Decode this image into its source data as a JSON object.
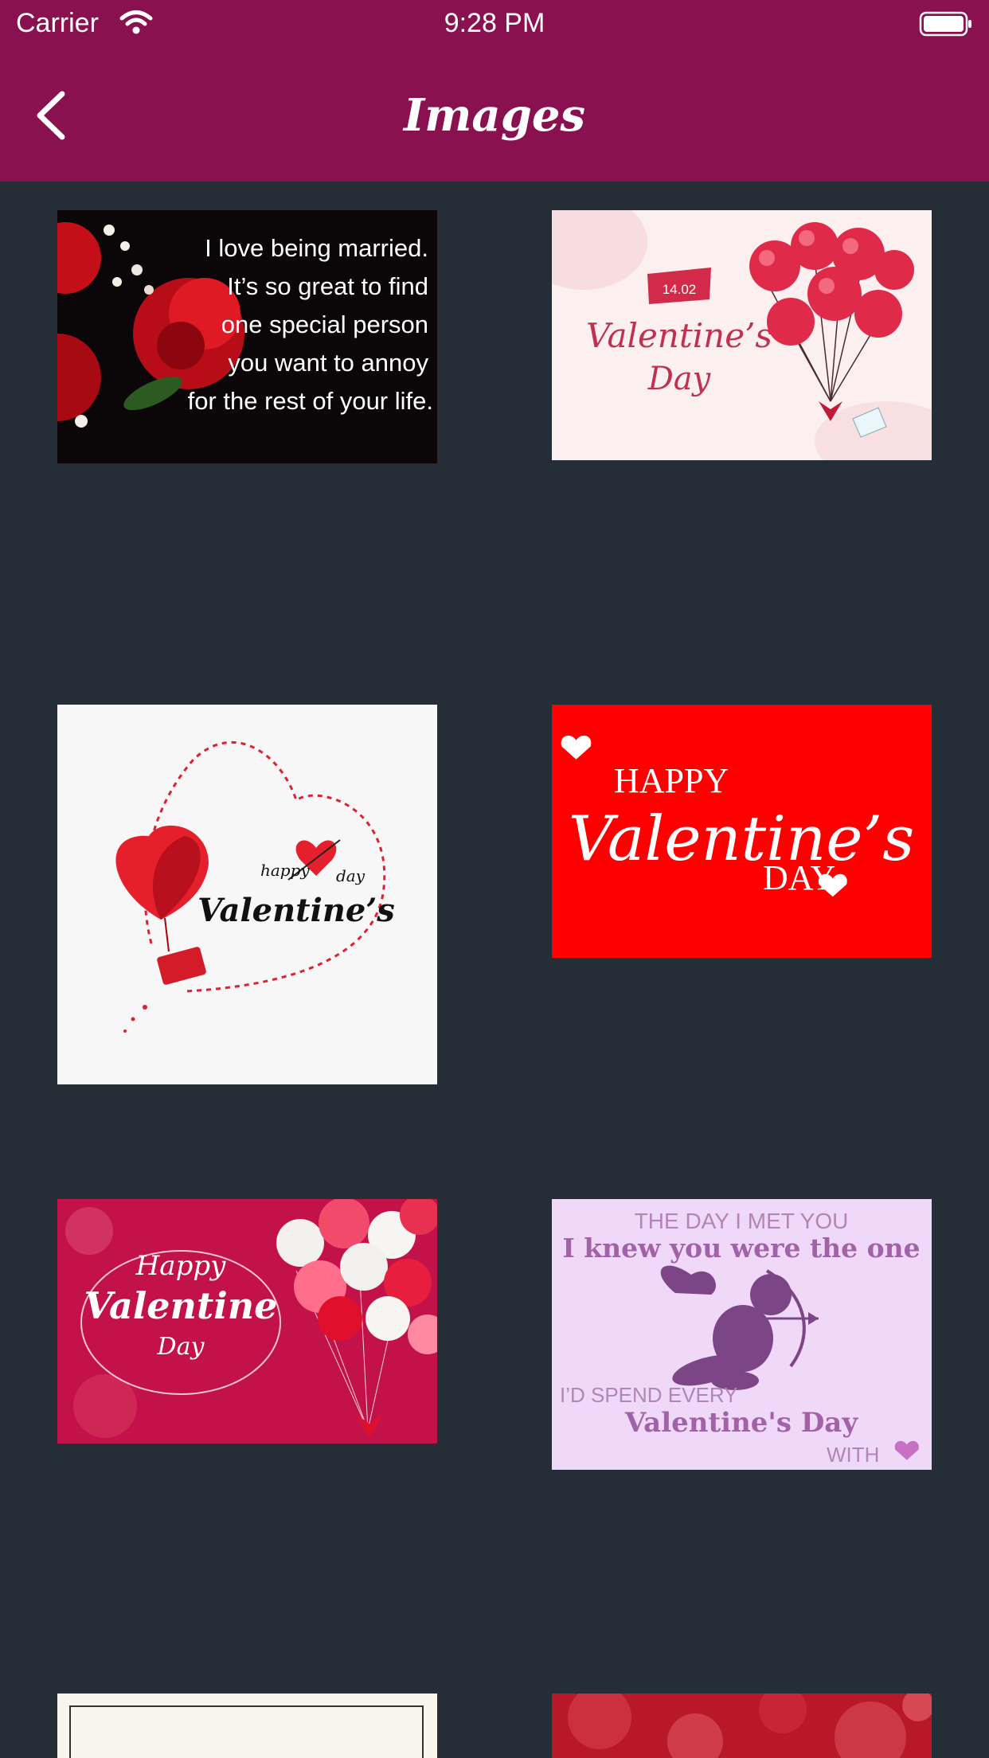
{
  "status_bar": {
    "carrier": "Carrier",
    "time": "9:28 PM"
  },
  "nav": {
    "title": "Images",
    "back_icon": "chevron-left-icon"
  },
  "colors": {
    "nav_bg": "#8a1150",
    "page_bg": "#252e36"
  },
  "images": [
    {
      "quote_lines": [
        "I love being married.",
        "It’s so great to find",
        "one special person",
        "you want to annoy",
        "for the rest of your life."
      ]
    },
    {
      "date": "14.02",
      "line1": "Valentine’s",
      "line2": "Day"
    },
    {
      "small_left": "happy",
      "small_right": "day",
      "main": "Valentine’s"
    },
    {
      "top": "HAPPY",
      "middle": "Valentine’s",
      "bottom": "DAY"
    },
    {
      "top": "Happy",
      "middle": "Valentine",
      "bottom": "Day"
    },
    {
      "line1": "THE DAY I MET YOU",
      "line2": "I knew you were the one",
      "line3": "I’D SPEND EVERY",
      "line4": "Valentine's Day",
      "line5": "WITH"
    },
    {},
    {}
  ]
}
